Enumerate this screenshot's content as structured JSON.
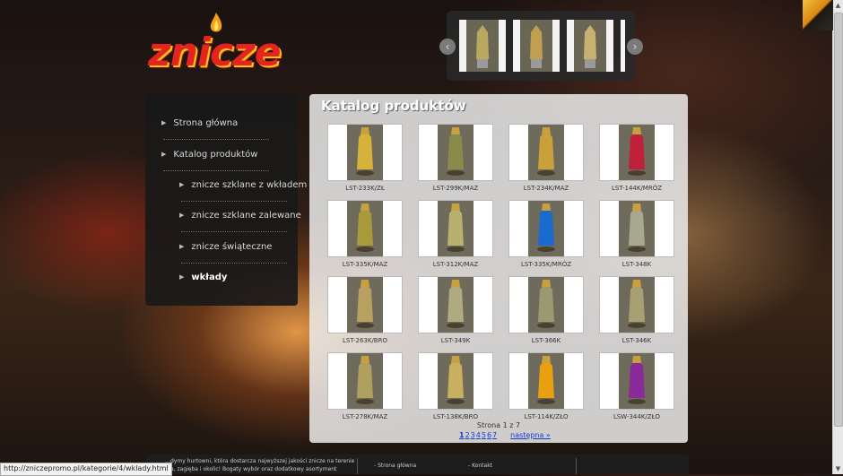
{
  "logo": {
    "text": "znicze"
  },
  "slider": {
    "prev_icon": "chevron-left-icon",
    "next_icon": "chevron-right-icon",
    "prev_glyph": "‹",
    "next_glyph": "›"
  },
  "sidebar": {
    "items": [
      {
        "label": "Strona główna",
        "level": 0,
        "active": false
      },
      {
        "label": "Katalog produktów",
        "level": 0,
        "active": false
      },
      {
        "label": "znicze szklane z wkładem",
        "level": 1,
        "active": false
      },
      {
        "label": "znicze szklane zalewane",
        "level": 1,
        "active": false
      },
      {
        "label": "znicze świąteczne",
        "level": 1,
        "active": false
      },
      {
        "label": "wkłady",
        "level": 1,
        "active": true
      }
    ]
  },
  "catalog": {
    "title": "Katalog produktów",
    "products": [
      {
        "code": "LST-233K/ZŁ",
        "color": "#d6b23a"
      },
      {
        "code": "LST-299K/MAZ",
        "color": "#8a8a4a"
      },
      {
        "code": "LST-234K/MAZ",
        "color": "#c8a13a"
      },
      {
        "code": "LST-144K/MRÓZ",
        "color": "#c0203a"
      },
      {
        "code": "LST-335K/MAZ",
        "color": "#a89a3a"
      },
      {
        "code": "LST-312K/MAZ",
        "color": "#b8b070"
      },
      {
        "code": "LST-335K/MRÓZ",
        "color": "#1a6ad0"
      },
      {
        "code": "LST-348K",
        "color": "#a8a890"
      },
      {
        "code": "LST-263K/BRO",
        "color": "#b8a060"
      },
      {
        "code": "LST-349K",
        "color": "#b0aa80"
      },
      {
        "code": "LST-366K",
        "color": "#9a9a70"
      },
      {
        "code": "LST-346K",
        "color": "#a8a070"
      },
      {
        "code": "LST-278K/MAZ",
        "color": "#b0a060"
      },
      {
        "code": "LST-138K/BRO",
        "color": "#c8b060"
      },
      {
        "code": "LST-114K/ZŁO",
        "color": "#e8a010"
      },
      {
        "code": "LSW-344K/ZŁO",
        "color": "#8a2a9a"
      }
    ]
  },
  "pager": {
    "info": "Strona 1 z 7",
    "pages": [
      "1",
      "2",
      "3",
      "4",
      "5",
      "6",
      "7"
    ],
    "current": "1",
    "next_label": "następna »"
  },
  "footer": {
    "text": "…dymy hurtowni, która dostarcza najwyższej jakości znicze na terenie …a, zagięba i okolic! Bogaty wybór oraz dodatkowy asortyment",
    "links": [
      "- Strona główna",
      "- Kontakt"
    ]
  },
  "status_bar": {
    "url": "http://zniczepromo.pl/kategorie/4/wklady.html"
  }
}
